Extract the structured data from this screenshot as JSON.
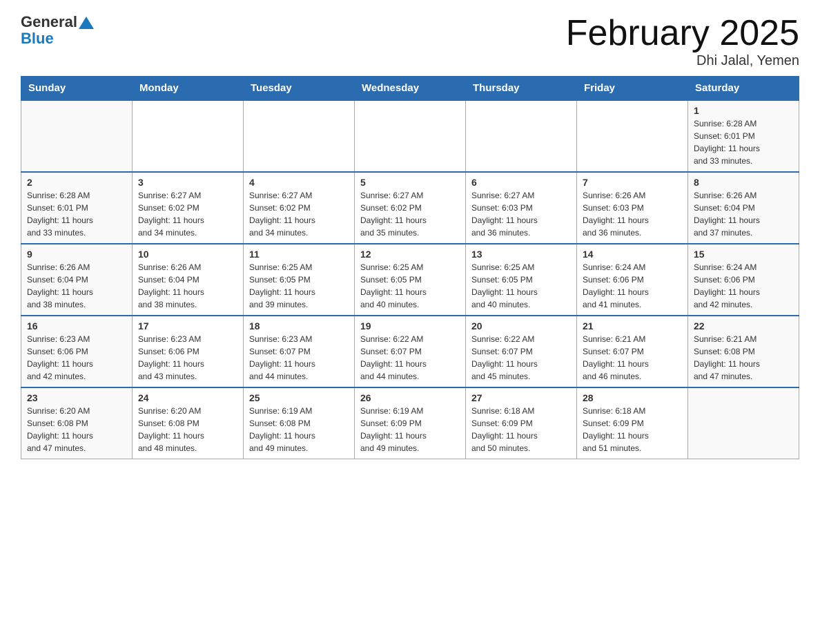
{
  "header": {
    "logo": {
      "general": "General",
      "blue": "Blue",
      "aria": "GeneralBlue logo"
    },
    "title": "February 2025",
    "location": "Dhi Jalal, Yemen"
  },
  "weekdays": [
    "Sunday",
    "Monday",
    "Tuesday",
    "Wednesday",
    "Thursday",
    "Friday",
    "Saturday"
  ],
  "weeks": [
    [
      {
        "day": "",
        "info": ""
      },
      {
        "day": "",
        "info": ""
      },
      {
        "day": "",
        "info": ""
      },
      {
        "day": "",
        "info": ""
      },
      {
        "day": "",
        "info": ""
      },
      {
        "day": "",
        "info": ""
      },
      {
        "day": "1",
        "info": "Sunrise: 6:28 AM\nSunset: 6:01 PM\nDaylight: 11 hours\nand 33 minutes."
      }
    ],
    [
      {
        "day": "2",
        "info": "Sunrise: 6:28 AM\nSunset: 6:01 PM\nDaylight: 11 hours\nand 33 minutes."
      },
      {
        "day": "3",
        "info": "Sunrise: 6:27 AM\nSunset: 6:02 PM\nDaylight: 11 hours\nand 34 minutes."
      },
      {
        "day": "4",
        "info": "Sunrise: 6:27 AM\nSunset: 6:02 PM\nDaylight: 11 hours\nand 34 minutes."
      },
      {
        "day": "5",
        "info": "Sunrise: 6:27 AM\nSunset: 6:02 PM\nDaylight: 11 hours\nand 35 minutes."
      },
      {
        "day": "6",
        "info": "Sunrise: 6:27 AM\nSunset: 6:03 PM\nDaylight: 11 hours\nand 36 minutes."
      },
      {
        "day": "7",
        "info": "Sunrise: 6:26 AM\nSunset: 6:03 PM\nDaylight: 11 hours\nand 36 minutes."
      },
      {
        "day": "8",
        "info": "Sunrise: 6:26 AM\nSunset: 6:04 PM\nDaylight: 11 hours\nand 37 minutes."
      }
    ],
    [
      {
        "day": "9",
        "info": "Sunrise: 6:26 AM\nSunset: 6:04 PM\nDaylight: 11 hours\nand 38 minutes."
      },
      {
        "day": "10",
        "info": "Sunrise: 6:26 AM\nSunset: 6:04 PM\nDaylight: 11 hours\nand 38 minutes."
      },
      {
        "day": "11",
        "info": "Sunrise: 6:25 AM\nSunset: 6:05 PM\nDaylight: 11 hours\nand 39 minutes."
      },
      {
        "day": "12",
        "info": "Sunrise: 6:25 AM\nSunset: 6:05 PM\nDaylight: 11 hours\nand 40 minutes."
      },
      {
        "day": "13",
        "info": "Sunrise: 6:25 AM\nSunset: 6:05 PM\nDaylight: 11 hours\nand 40 minutes."
      },
      {
        "day": "14",
        "info": "Sunrise: 6:24 AM\nSunset: 6:06 PM\nDaylight: 11 hours\nand 41 minutes."
      },
      {
        "day": "15",
        "info": "Sunrise: 6:24 AM\nSunset: 6:06 PM\nDaylight: 11 hours\nand 42 minutes."
      }
    ],
    [
      {
        "day": "16",
        "info": "Sunrise: 6:23 AM\nSunset: 6:06 PM\nDaylight: 11 hours\nand 42 minutes."
      },
      {
        "day": "17",
        "info": "Sunrise: 6:23 AM\nSunset: 6:06 PM\nDaylight: 11 hours\nand 43 minutes."
      },
      {
        "day": "18",
        "info": "Sunrise: 6:23 AM\nSunset: 6:07 PM\nDaylight: 11 hours\nand 44 minutes."
      },
      {
        "day": "19",
        "info": "Sunrise: 6:22 AM\nSunset: 6:07 PM\nDaylight: 11 hours\nand 44 minutes."
      },
      {
        "day": "20",
        "info": "Sunrise: 6:22 AM\nSunset: 6:07 PM\nDaylight: 11 hours\nand 45 minutes."
      },
      {
        "day": "21",
        "info": "Sunrise: 6:21 AM\nSunset: 6:07 PM\nDaylight: 11 hours\nand 46 minutes."
      },
      {
        "day": "22",
        "info": "Sunrise: 6:21 AM\nSunset: 6:08 PM\nDaylight: 11 hours\nand 47 minutes."
      }
    ],
    [
      {
        "day": "23",
        "info": "Sunrise: 6:20 AM\nSunset: 6:08 PM\nDaylight: 11 hours\nand 47 minutes."
      },
      {
        "day": "24",
        "info": "Sunrise: 6:20 AM\nSunset: 6:08 PM\nDaylight: 11 hours\nand 48 minutes."
      },
      {
        "day": "25",
        "info": "Sunrise: 6:19 AM\nSunset: 6:08 PM\nDaylight: 11 hours\nand 49 minutes."
      },
      {
        "day": "26",
        "info": "Sunrise: 6:19 AM\nSunset: 6:09 PM\nDaylight: 11 hours\nand 49 minutes."
      },
      {
        "day": "27",
        "info": "Sunrise: 6:18 AM\nSunset: 6:09 PM\nDaylight: 11 hours\nand 50 minutes."
      },
      {
        "day": "28",
        "info": "Sunrise: 6:18 AM\nSunset: 6:09 PM\nDaylight: 11 hours\nand 51 minutes."
      },
      {
        "day": "",
        "info": ""
      }
    ]
  ]
}
